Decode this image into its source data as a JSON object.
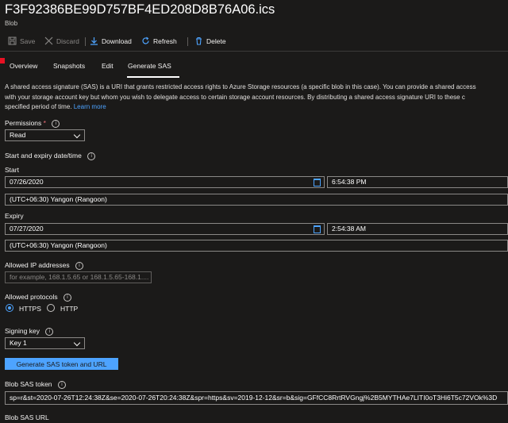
{
  "blade": {
    "title": "F3F92386BE99D757BF4ED208D8B76A06.ics",
    "subtitle": "Blob"
  },
  "toolbar": {
    "save": "Save",
    "discard": "Discard",
    "download": "Download",
    "refresh": "Refresh",
    "delete": "Delete"
  },
  "tabs": [
    "Overview",
    "Snapshots",
    "Edit",
    "Generate SAS"
  ],
  "description": {
    "line1": "A shared access signature (SAS) is a URI that grants restricted access rights to Azure Storage resources (a specific blob in this case). You can provide a shared access",
    "line2": "with your storage account key but whom you wish to delegate access to certain storage account resources. By distributing a shared access signature URI to these c",
    "line3": "specified period of time.",
    "link": "Learn more"
  },
  "permissions": {
    "label": "Permissions",
    "required": "*",
    "value": "Read"
  },
  "dates": {
    "section_label": "Start and expiry date/time",
    "start_label": "Start",
    "start_date": "07/26/2020",
    "start_time": "6:54:38 PM",
    "start_tz": "(UTC+06:30) Yangon (Rangoon)",
    "expiry_label": "Expiry",
    "expiry_date": "07/27/2020",
    "expiry_time": "2:54:38 AM",
    "expiry_tz": "(UTC+06:30) Yangon (Rangoon)"
  },
  "ip": {
    "label": "Allowed IP addresses",
    "placeholder": "for example, 168.1.5.65 or 168.1.5.65-168.1...."
  },
  "protocols": {
    "label": "Allowed protocols",
    "https": "HTTPS",
    "http": "HTTP",
    "selected": "HTTPS"
  },
  "signing": {
    "label": "Signing key",
    "value": "Key 1"
  },
  "generate_button": "Generate SAS token and URL",
  "token": {
    "label": "Blob SAS token",
    "value": "sp=r&st=2020-07-26T12:24:38Z&se=2020-07-26T20:24:38Z&spr=https&sv=2019-12-12&sr=b&sig=GFfCC8RrtRVGngj%2B5MYTHAe7LITI0oT3Hi6T5c72VOk%3D"
  },
  "url": {
    "label": "Blob SAS URL"
  },
  "icon_color_accent": "#4da3ff"
}
